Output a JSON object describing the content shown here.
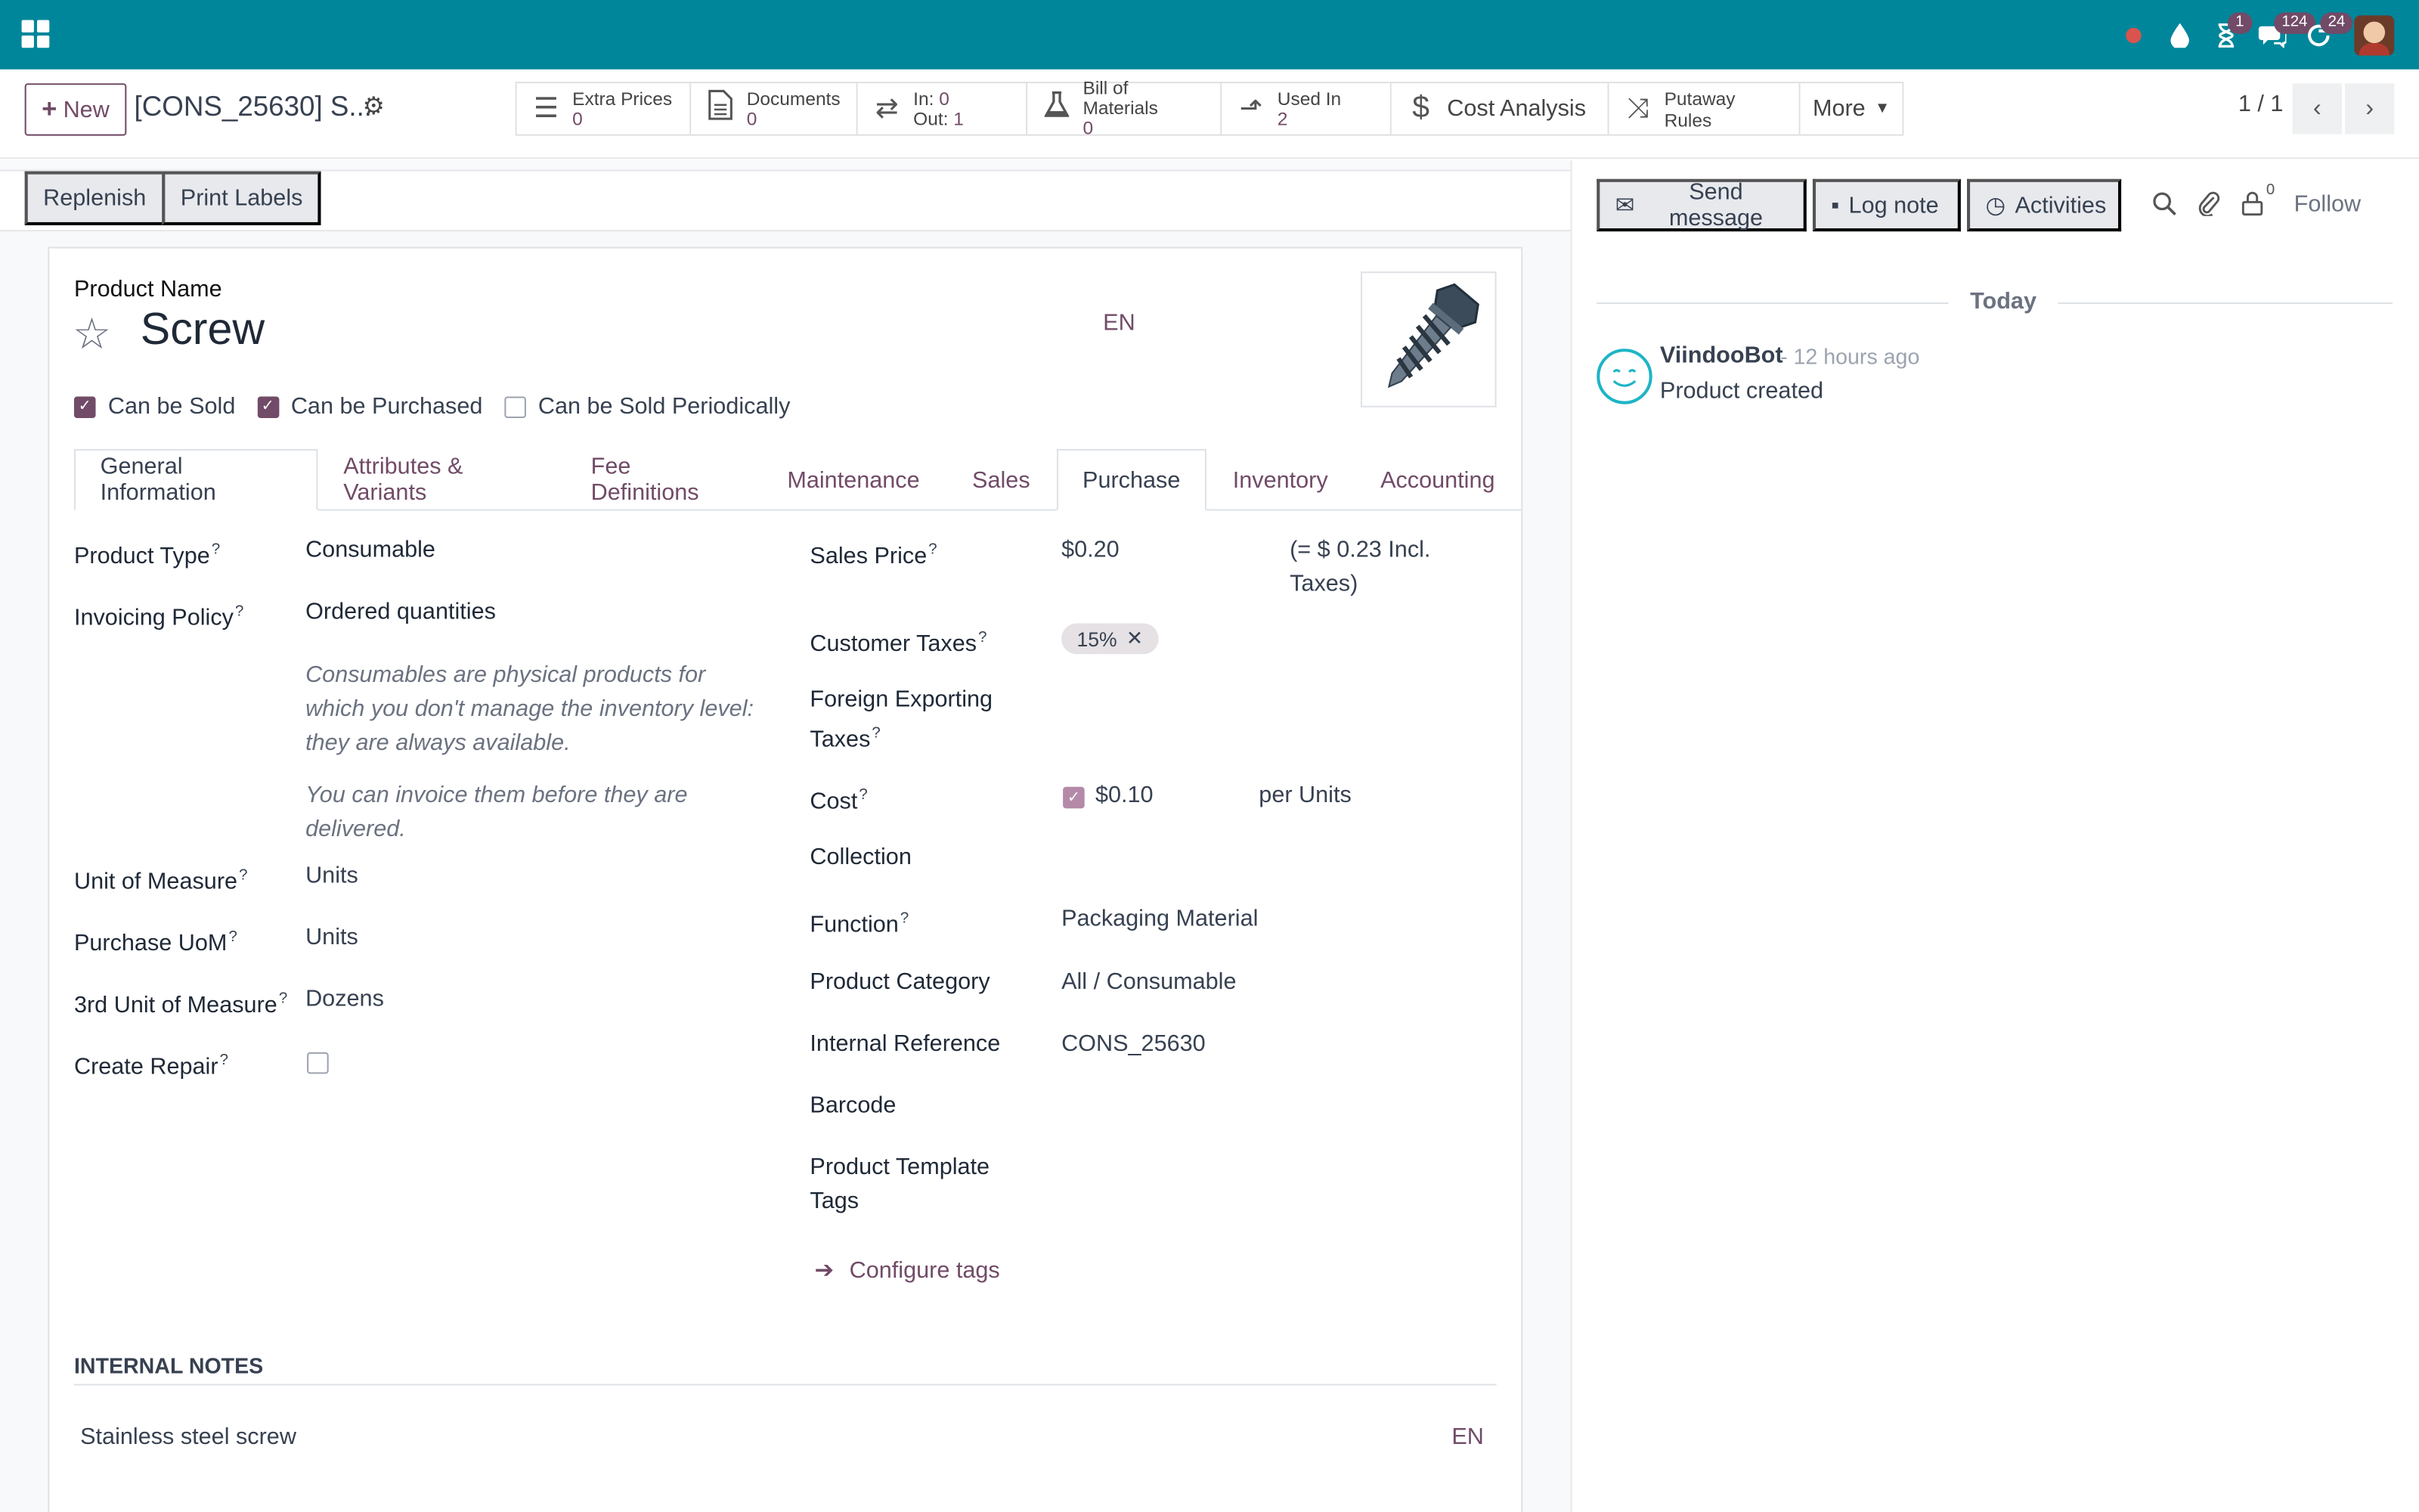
{
  "topbar": {
    "badges": {
      "activities": "1",
      "messages": "124",
      "refresh": "24"
    }
  },
  "controlbar": {
    "new_label": "New",
    "record_title": "[CONS_25630] S...",
    "smart_buttons": [
      {
        "label": "Extra Prices",
        "value": "0",
        "icon": "list-icon"
      },
      {
        "label": "Documents",
        "value": "0",
        "icon": "document-icon"
      },
      {
        "label_in": "In:",
        "in_value": "0",
        "label_out": "Out:",
        "out_value": "1",
        "icon": "transfer-icon"
      },
      {
        "label": "Bill of Materials",
        "value": "0",
        "icon": "flask-icon"
      },
      {
        "label": "Used In",
        "value": "2",
        "icon": "level-up-icon"
      },
      {
        "label": "Cost Analysis",
        "icon": "dollar-icon"
      },
      {
        "label": "Putaway Rules",
        "icon": "random-icon"
      },
      {
        "label": "More",
        "icon": "caret-down-icon"
      }
    ],
    "pager": "1 / 1"
  },
  "header_buttons": {
    "replenish": "Replenish",
    "print_labels": "Print Labels"
  },
  "form": {
    "product_name_label": "Product Name",
    "product_name": "Screw",
    "lang": "EN",
    "checkboxes": [
      {
        "label": "Can be Sold",
        "checked": true
      },
      {
        "label": "Can be Purchased",
        "checked": true
      },
      {
        "label": "Can be Sold Periodically",
        "checked": false
      }
    ],
    "tabs": [
      "General Information",
      "Attributes & Variants",
      "Fee Definitions",
      "Maintenance",
      "Sales",
      "Purchase",
      "Inventory",
      "Accounting"
    ],
    "active_tab": "General Information",
    "left": {
      "product_type_label": "Product Type",
      "product_type": "Consumable",
      "invoicing_policy_label": "Invoicing Policy",
      "invoicing_policy": "Ordered quantities",
      "help1": "Consumables are physical products for which you don't manage the inventory level: they are always available.",
      "help2": "You can invoice them before they are delivered.",
      "uom_label": "Unit of Measure",
      "uom": "Units",
      "purchase_uom_label": "Purchase UoM",
      "purchase_uom": "Units",
      "third_uom_label": "3rd Unit of Measure",
      "third_uom": "Dozens",
      "create_repair_label": "Create Repair"
    },
    "right": {
      "sales_price_label": "Sales Price",
      "sales_price": "$0.20",
      "incl_taxes": "(= $ 0.23 Incl. Taxes)",
      "customer_taxes_label": "Customer Taxes",
      "customer_tax_tag": "15%",
      "foreign_taxes_label": "Foreign Exporting Taxes",
      "cost_label": "Cost",
      "cost": "$0.10",
      "per_units": "per Units",
      "collection_label": "Collection",
      "function_label": "Function",
      "function": "Packaging Material",
      "category_label": "Product Category",
      "category": "All / Consumable",
      "internal_ref_label": "Internal Reference",
      "internal_ref": "CONS_25630",
      "barcode_label": "Barcode",
      "template_tags_label": "Product Template Tags",
      "configure_tags": "Configure tags"
    },
    "internal_notes_header": "INTERNAL NOTES",
    "internal_notes": "Stainless steel screw",
    "notes_lang": "EN"
  },
  "chatter": {
    "send_message": "Send message",
    "log_note": "Log note",
    "activities": "Activities",
    "followers_count": "0",
    "follow": "Follow",
    "today": "Today",
    "message": {
      "author": "ViindooBot",
      "time": "- 12 hours ago",
      "body": "Product created"
    }
  },
  "colors": {
    "topbar": "#00869a",
    "accent": "#714b67"
  }
}
